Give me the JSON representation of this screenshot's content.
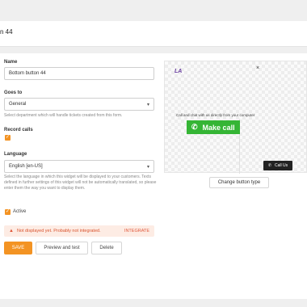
{
  "header": {
    "title": "n 44"
  },
  "form": {
    "name_label": "Name",
    "name_value": "Bottom button 44",
    "goes_to_label": "Goes to",
    "goes_to_value": "General",
    "goes_to_help": "Select department which will handle tickets created from this form.",
    "record_calls_label": "Record calls",
    "record_calls_checked": true,
    "language_label": "Language",
    "language_value": "English [en-US]",
    "language_help": "Select the language in which this widget will be displayed to your customers. Texts defined in further settings of this widget will not be automatically translated, so please enter them the way you want to display them.",
    "active_label": "Active",
    "active_checked": true
  },
  "warning": {
    "text": "Not displayed yet. Probably not integrated.",
    "action": "INTEGRATE"
  },
  "actions": {
    "save": "SAVE",
    "preview": "Preview and test",
    "delete": "Delete"
  },
  "preview": {
    "logo": "LA",
    "close": "×",
    "tagline": "Call and chat with us directly from your computer",
    "make_call": "Make call",
    "call_us": "Call Us",
    "change_button": "Change button type"
  },
  "colors": {
    "accent": "#f39323",
    "call_green": "#35b535",
    "warning_text": "#d9532e"
  }
}
